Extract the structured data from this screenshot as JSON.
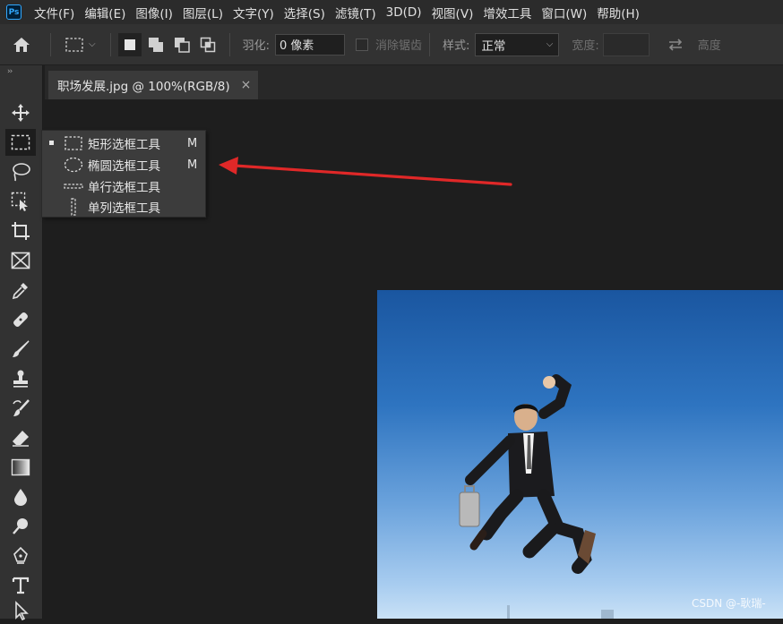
{
  "app": {
    "logo": "Ps"
  },
  "menu": [
    "文件(F)",
    "编辑(E)",
    "图像(I)",
    "图层(L)",
    "文字(Y)",
    "选择(S)",
    "滤镜(T)",
    "3D(D)",
    "视图(V)",
    "增效工具",
    "窗口(W)",
    "帮助(H)"
  ],
  "options": {
    "feather_label": "羽化:",
    "feather_value": "0 像素",
    "antialias_label": "消除锯齿",
    "style_label": "样式:",
    "style_value": "正常",
    "width_label": "宽度:",
    "height_label": "高度"
  },
  "tab": {
    "title": "职场发展.jpg @ 100%(RGB/8)",
    "close": "×"
  },
  "flyout": {
    "items": [
      {
        "label": "矩形选框工具",
        "shortcut": "M",
        "icon": "rect-marquee-icon",
        "active": true
      },
      {
        "label": "椭圆选框工具",
        "shortcut": "M",
        "icon": "ellipse-marquee-icon",
        "active": false
      },
      {
        "label": "单行选框工具",
        "shortcut": "",
        "icon": "single-row-marquee-icon",
        "active": false
      },
      {
        "label": "单列选框工具",
        "shortcut": "",
        "icon": "single-column-marquee-icon",
        "active": false
      }
    ]
  },
  "tools": [
    "move-tool",
    "marquee-tool",
    "lasso-tool",
    "object-selection-tool",
    "crop-tool",
    "frame-tool",
    "eyedropper-tool",
    "healing-brush-tool",
    "brush-tool",
    "clone-stamp-tool",
    "history-brush-tool",
    "eraser-tool",
    "gradient-tool",
    "blur-tool",
    "dodge-tool",
    "pen-tool",
    "type-tool",
    "path-selection-tool"
  ],
  "watermark": "CSDN @-耿瑞-",
  "colors": {
    "arrow": "#e02828",
    "accent": "#31a8ff"
  }
}
